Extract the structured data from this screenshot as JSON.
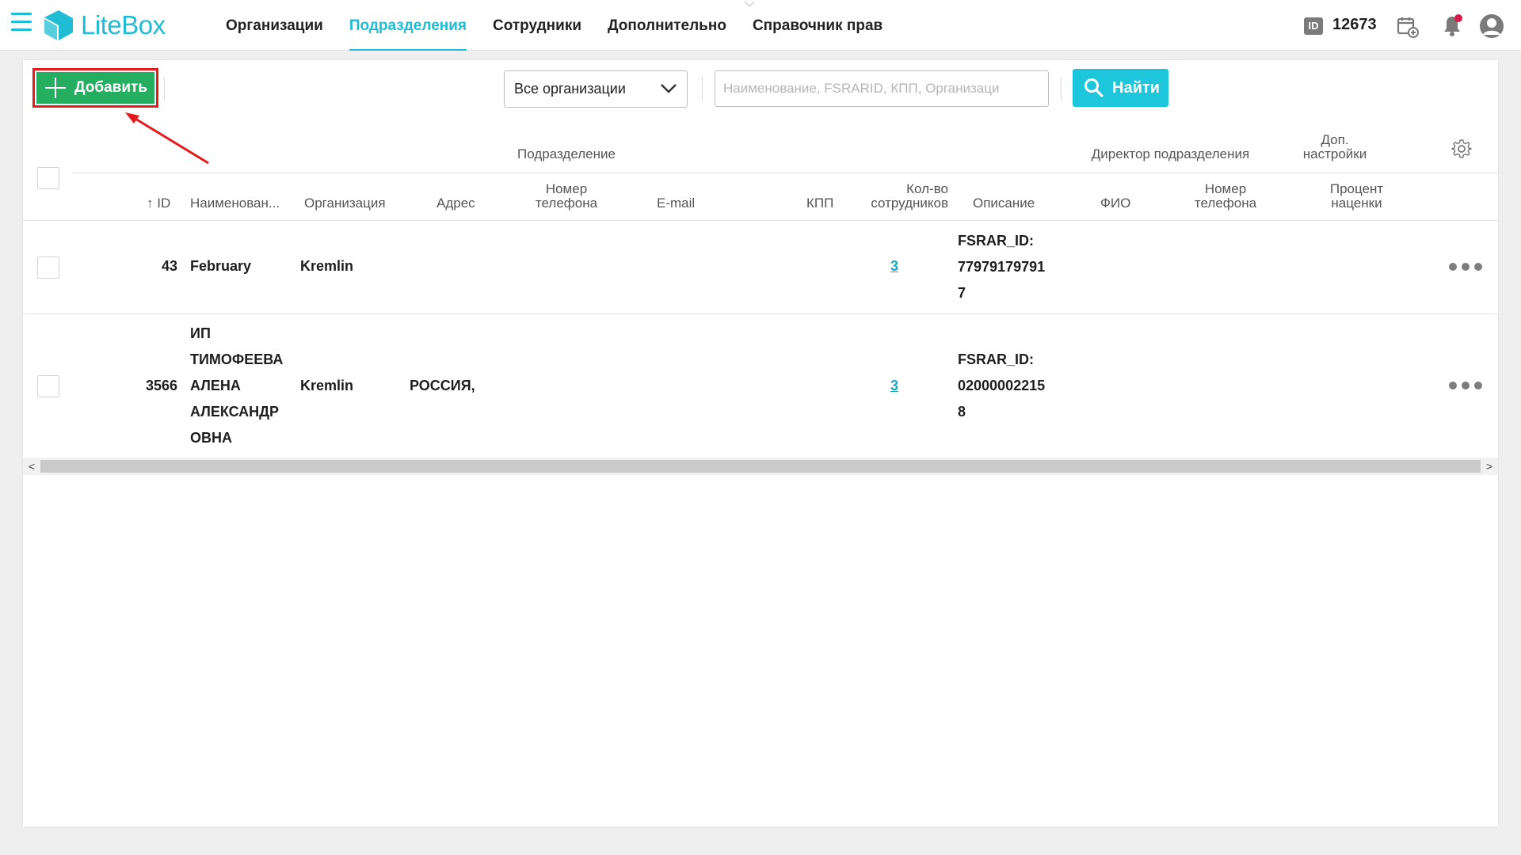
{
  "header": {
    "logo_text": "LiteBox",
    "nav": [
      {
        "label": "Организации"
      },
      {
        "label": "Подразделения",
        "active": true
      },
      {
        "label": "Сотрудники"
      },
      {
        "label": "Дополнительно"
      },
      {
        "label": "Справочник прав"
      }
    ],
    "id_badge": "ID",
    "account_id": "12673",
    "icons": [
      "hamburger-menu-icon",
      "calendar-add-icon",
      "bell-icon",
      "user-profile-icon"
    ],
    "notification_dot_color": "#d7194b",
    "accent_color": "#20bcd3"
  },
  "toolbar": {
    "add_label": "Добавить",
    "org_select_value": "Все организации",
    "search_placeholder": "Наименование, FSRARID, КПП, Организаци",
    "search_value": "",
    "find_label": "Найти",
    "add_color": "#25ae5f",
    "find_color": "#1ec6dc"
  },
  "table": {
    "groups": {
      "division": "Подразделение",
      "director": "Директор подразделения",
      "extra": "Доп. настройки"
    },
    "columns": {
      "id": "ID",
      "name": "Наименован...",
      "organization": "Организация",
      "address": "Адрес",
      "phone": "Номер телефона",
      "email": "E-mail",
      "kpp": "КПП",
      "employees": "Кол-во сотрудников",
      "description": "Описание",
      "director_name": "ФИО",
      "director_phone": "Номер телефона",
      "markup": "Процент наценки"
    },
    "rows": [
      {
        "id": "43",
        "name_lines": [
          "February"
        ],
        "organization": "Kremlin",
        "address": "",
        "employees": "3",
        "description_lines": [
          "FSRAR_ID:",
          "77979179791",
          "7"
        ]
      },
      {
        "id": "3566",
        "name_lines": [
          "ИП",
          "ТИМОФЕЕВА",
          "АЛЕНА",
          "АЛЕКСАНДР",
          "ОВНА"
        ],
        "organization": "Kremlin",
        "address": "РОССИЯ,",
        "employees": "3",
        "description_lines": [
          "FSRAR_ID:",
          "02000002215",
          "8"
        ]
      }
    ]
  }
}
